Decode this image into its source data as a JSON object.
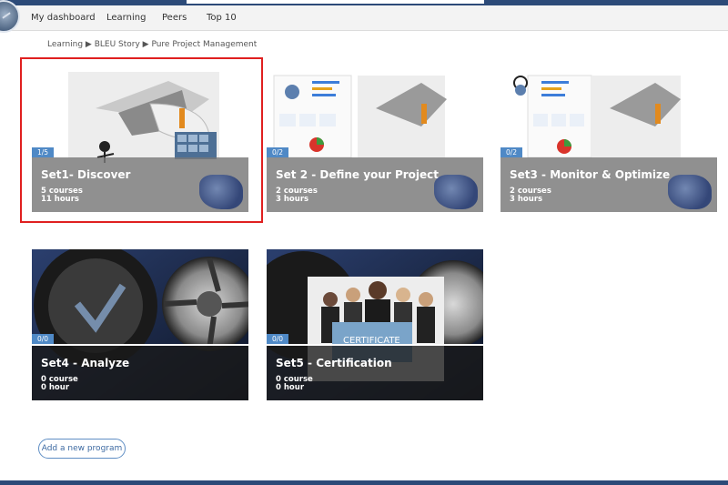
{
  "nav": {
    "items": [
      {
        "label": "My dashboard"
      },
      {
        "label": "Learning"
      },
      {
        "label": "Peers"
      },
      {
        "label": "Top 10"
      }
    ]
  },
  "breadcrumb": "Learning ▶ BLEU Story ▶ Pure Project Management",
  "cards": [
    {
      "title": "Set1- Discover",
      "line1": "5 courses",
      "line2": "11 hours",
      "progress": "1/5"
    },
    {
      "title": "Set 2 - Define your Project",
      "line1": "2 courses",
      "line2": "3 hours",
      "progress": "0/2"
    },
    {
      "title": "Set3 - Monitor & Optimize",
      "line1": "2 courses",
      "line2": "3 hours",
      "progress": "0/2"
    },
    {
      "title": "Set4 - Analyze",
      "line1": "0 course",
      "line2": "0 hour",
      "progress": "0/0"
    },
    {
      "title": "Set5 - Certification",
      "line1": "0 course",
      "line2": "0 hour",
      "progress": "0/0"
    }
  ],
  "add_program_label": "Add a new program",
  "certificate_text": "CERTIFICATE",
  "colors": {
    "accent": "#4f89c6",
    "header": "#2c4a78",
    "selection": "#e02020"
  }
}
